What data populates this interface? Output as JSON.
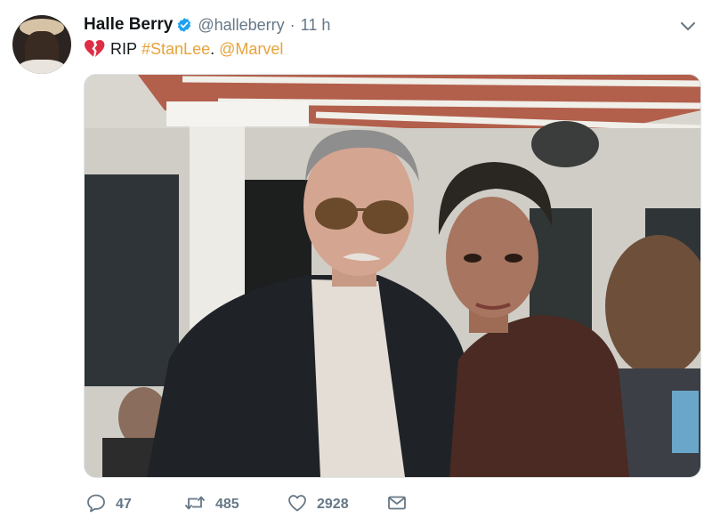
{
  "author": {
    "name": "Halle Berry",
    "handle": "@halleberry",
    "separator": "·",
    "time": "11 h"
  },
  "tweet": {
    "word_rip": "RIP",
    "hashtag": "#StanLee",
    "period": ".",
    "mention": "@Marvel",
    "icon": "broken-heart-icon"
  },
  "actions": {
    "replies": "47",
    "retweets": "485",
    "likes": "2928"
  },
  "colors": {
    "link": "#e8a33a",
    "verified": "#1da1f2",
    "muted": "#657786",
    "heart": "#dd2e44"
  }
}
